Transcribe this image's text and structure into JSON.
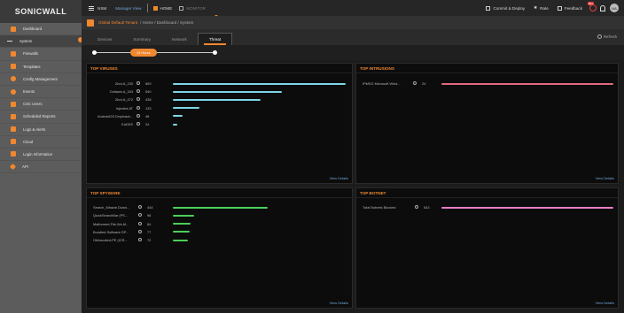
{
  "logo": "SONICWALL",
  "sidebar": {
    "items": [
      {
        "label": "Dashboard"
      },
      {
        "label": "System"
      },
      {
        "label": "Firewalls"
      },
      {
        "label": "Templates"
      },
      {
        "label": "Config Management"
      },
      {
        "label": "Events"
      },
      {
        "label": "CSC Users"
      },
      {
        "label": "Scheduled Reports"
      },
      {
        "label": "Logs & Alerts"
      },
      {
        "label": "Cloud"
      },
      {
        "label": "Login Information"
      },
      {
        "label": "API"
      }
    ]
  },
  "topbar": {
    "nsm": "NSM",
    "manager_view": "Manager View",
    "home": "HOME",
    "monitor": "MONITOR",
    "commit": "Commit & Deploy",
    "rate": "Rate",
    "feedback": "Feedback",
    "notify_badge": "99+",
    "avatar": "NA"
  },
  "breadcrumb": {
    "tenant": "Global Default Tenant",
    "path": "/ Home / Dashboard / System"
  },
  "tabs": [
    {
      "label": "Devices"
    },
    {
      "label": "Summary"
    },
    {
      "label": "Network"
    },
    {
      "label": "Threat"
    }
  ],
  "refresh": "Refresh",
  "slider": {
    "label": "24 Hours"
  },
  "colors": {
    "accent": "#f0882f",
    "virus": "#7fd6e8",
    "intrusion": "#e06a7e",
    "spyware": "#4ccf5a",
    "botnet": "#e87fc7"
  },
  "panels": {
    "viruses": {
      "title": "TOP VIRUSES",
      "view": "View Details",
      "max": 859,
      "rows": [
        {
          "name": "Zbot.A_230",
          "value": 859
        },
        {
          "name": "Outlaws.A_343",
          "value": 540
        },
        {
          "name": "Zbot.A_472",
          "value": 438
        },
        {
          "name": "Injected.AT",
          "value": 133
        },
        {
          "name": "AndroidOS.Dropback...",
          "value": 48
        },
        {
          "name": "EaDDS",
          "value": 24
        }
      ]
    },
    "intrusions": {
      "title": "TOP INTRUSIONS",
      "view": "View Details",
      "max": 24,
      "rows": [
        {
          "name": "IPMSG Microsoft Wind...",
          "value": 24
        }
      ]
    },
    "spyware": {
      "title": "TOP SPYWARE",
      "view": "View Details",
      "max": 444,
      "rows": [
        {
          "name": "Search_Miracle.Down...",
          "value": 444
        },
        {
          "name": "QuickSearchBar (PS...",
          "value": 98
        },
        {
          "name": "Malformed-File.Ws.M...",
          "value": 84
        },
        {
          "name": "Bundled-Software.SP...",
          "value": 77
        },
        {
          "name": "Obfuscated-PE (ICR...",
          "value": 72
        }
      ]
    },
    "botnet": {
      "title": "TOP BOTNET",
      "view": "View Details",
      "max": 543,
      "rows": [
        {
          "name": "Total Botnets Blocked",
          "value": 543
        }
      ]
    }
  }
}
